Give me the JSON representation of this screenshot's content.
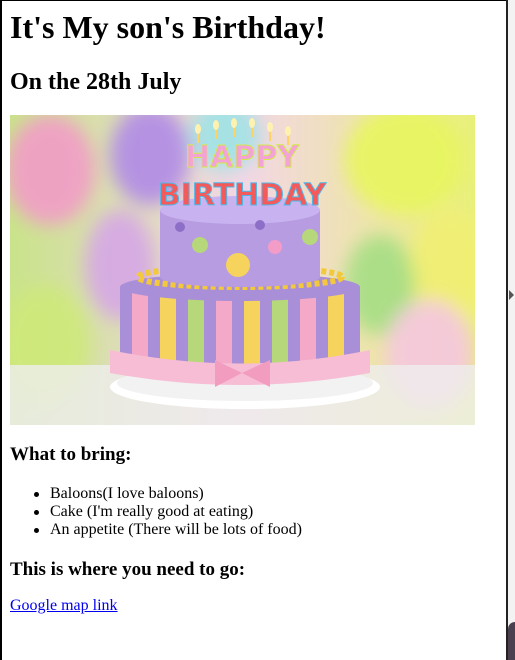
{
  "page": {
    "title": "It's My son's Birthday!",
    "subtitle": "On the 28th July",
    "image": {
      "icon": "birthday-cake-photo",
      "topper_line1": "HAPPY",
      "topper_line2": "BIRTHDAY"
    },
    "bring_heading": "What to bring:",
    "bring_items": [
      "Baloons(I love baloons)",
      "Cake (I'm really good at eating)",
      "An appetite (There will be lots of food)"
    ],
    "go_heading": "This is where you need to go:",
    "map_link": "Google map link"
  },
  "colors": {
    "link": "#0000ee",
    "cake_purple": "#a98fd8",
    "cake_pink": "#f4a9c8",
    "cake_yellow": "#f6d35c",
    "cake_green": "#b6d77a"
  }
}
